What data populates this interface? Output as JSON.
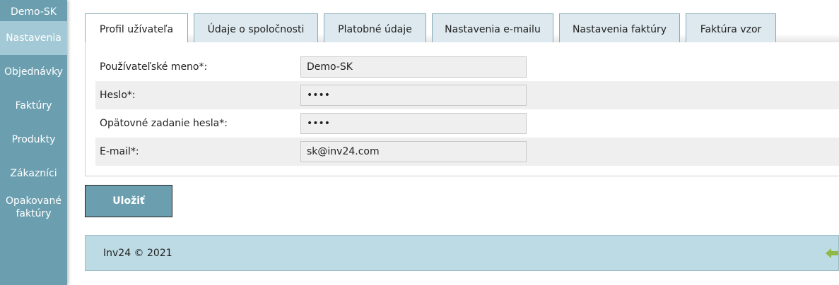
{
  "sidebar": {
    "account": "Demo-SK",
    "items": [
      {
        "label": "Nastavenia"
      },
      {
        "label": "Objednávky"
      },
      {
        "label": "Faktúry"
      },
      {
        "label": "Produkty"
      },
      {
        "label": "Zákazníci"
      },
      {
        "label_line1": "Opakované",
        "label_line2": "faktúry"
      }
    ]
  },
  "tabs": [
    {
      "label": "Profil užívateľa"
    },
    {
      "label": "Údaje o spoločnosti"
    },
    {
      "label": "Platobné údaje"
    },
    {
      "label": "Nastavenia e-mailu"
    },
    {
      "label": "Nastavenia faktúry"
    },
    {
      "label": "Faktúra vzor"
    }
  ],
  "form": {
    "fields": [
      {
        "label": "Používateľské meno*:",
        "value": "Demo-SK"
      },
      {
        "label": "Heslo*:",
        "value": "••••"
      },
      {
        "label": "Opätovné zadanie hesla*:",
        "value": "••••"
      },
      {
        "label": "E-mail*:",
        "value": "sk@inv24.com"
      }
    ]
  },
  "actions": {
    "save_label": "Uložiť"
  },
  "footer": {
    "text": "Inv24 © 2021"
  },
  "colors": {
    "sidebar": "#6b9fb0",
    "sidebar_active": "#a3c9d6",
    "footer": "#bddbe5",
    "back_arrow": "#8fb848"
  }
}
